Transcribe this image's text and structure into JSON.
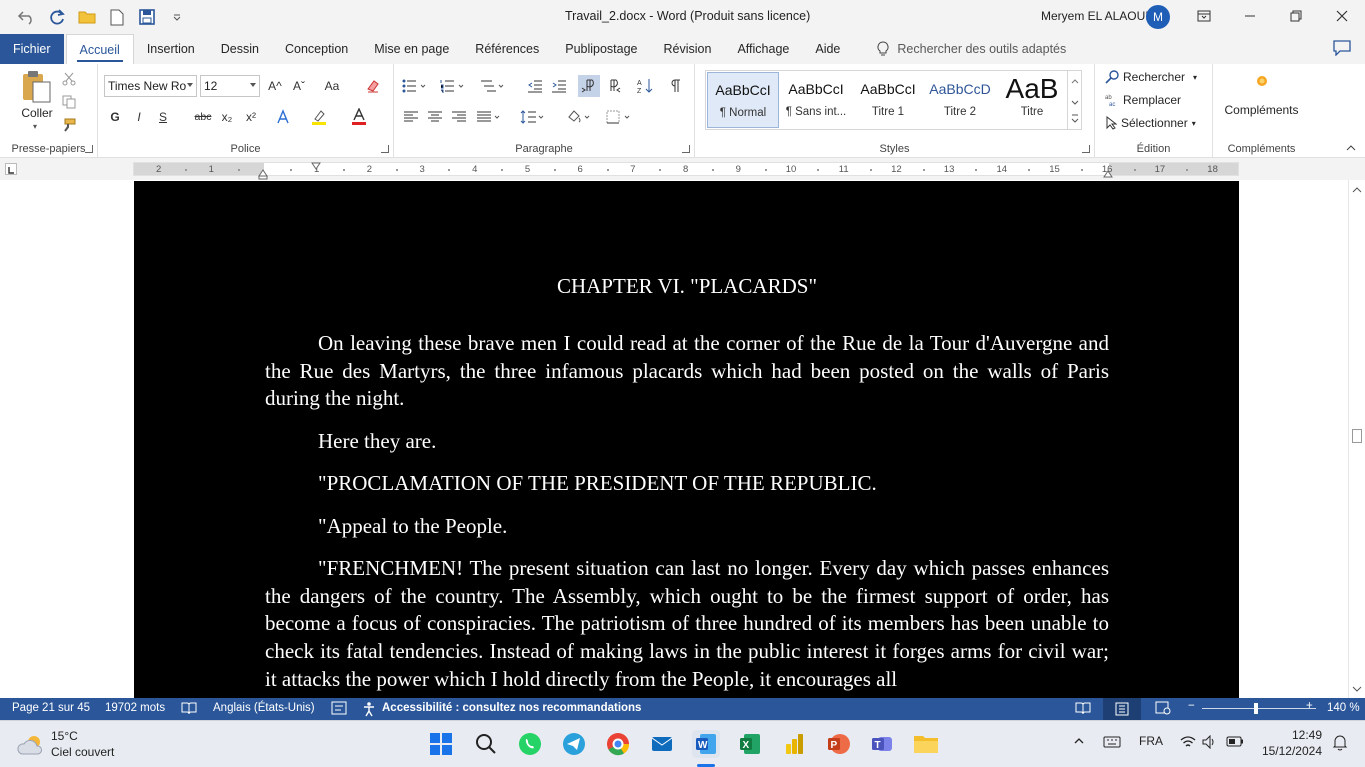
{
  "window": {
    "title": "Travail_2.docx  -  Word (Produit sans licence)",
    "user_name": "Meryem EL ALAOUI",
    "avatar_initial": "M"
  },
  "tabs": [
    {
      "label": "Fichier"
    },
    {
      "label": "Accueil"
    },
    {
      "label": "Insertion"
    },
    {
      "label": "Dessin"
    },
    {
      "label": "Conception"
    },
    {
      "label": "Mise en page"
    },
    {
      "label": "Références"
    },
    {
      "label": "Publipostage"
    },
    {
      "label": "Révision"
    },
    {
      "label": "Affichage"
    },
    {
      "label": "Aide"
    }
  ],
  "search_tools": "Rechercher des outils adaptés",
  "ribbon": {
    "clipboard": {
      "paste": "Coller",
      "label": "Presse-papiers"
    },
    "font": {
      "name": "Times New Ro",
      "size": "12",
      "label": "Police",
      "bold": "G",
      "italic": "I",
      "underline": "S",
      "strike": "abc",
      "sub": "x₂",
      "sup": "x²",
      "grow": "A^",
      "shrink": "Aˇ",
      "case": "Aa"
    },
    "paragraph": {
      "label": "Paragraphe"
    },
    "styles": {
      "label": "Styles",
      "items": [
        {
          "preview": "AaBbCcI",
          "name": "¶ Normal"
        },
        {
          "preview": "AaBbCcI",
          "name": "¶ Sans int..."
        },
        {
          "preview": "AaBbCcI",
          "name": "Titre 1"
        },
        {
          "preview": "AaBbCcD",
          "name": "Titre 2"
        },
        {
          "preview": "AaB",
          "name": "Titre"
        }
      ]
    },
    "editing": {
      "find": "Rechercher",
      "replace": "Remplacer",
      "select": "Sélectionner",
      "label": "Édition"
    },
    "addins": {
      "button": "Compléments",
      "label": "Compléments"
    }
  },
  "ruler_numbers": [
    "2",
    "1",
    "1",
    "2",
    "3",
    "4",
    "5",
    "6",
    "7",
    "8",
    "9",
    "10",
    "11",
    "12",
    "13",
    "14",
    "15",
    "16",
    "17",
    "18"
  ],
  "document": {
    "heading": "CHAPTER VI. \"PLACARDS\"",
    "paragraphs": [
      "On leaving these brave men I could read at the corner of the Rue de la Tour d'Auvergne and the Rue des Martyrs, the three infamous placards which had been posted on the walls of Paris during the night.",
      "Here they are.",
      "\"PROCLAMATION OF THE PRESIDENT OF THE REPUBLIC.",
      "\"Appeal to the People.",
      "\"FRENCHMEN! The present situation can last no longer. Every day which passes enhances the dangers of the country. The Assembly, which ought to be the firmest support of order, has become a focus of conspiracies. The patriotism of three hundred of its members has been unable to check its fatal tendencies. Instead of making laws in the public interest it forges arms for civil war; it attacks the power which I hold directly from the People, it encourages all"
    ]
  },
  "status": {
    "page": "Page 21 sur 45",
    "words": "19702 mots",
    "language": "Anglais (États-Unis)",
    "accessibility": "Accessibilité : consultez nos recommandations",
    "zoom": "140 %",
    "zoom_minus": "−",
    "zoom_plus": "+"
  },
  "taskbar": {
    "temp": "15°C",
    "weather": "Ciel couvert",
    "lang": "FRA",
    "time": "12:49",
    "date": "15/12/2024"
  },
  "colors": {
    "accent": "#2b579a",
    "page_bg": "#000000",
    "text": "#ffffff"
  }
}
